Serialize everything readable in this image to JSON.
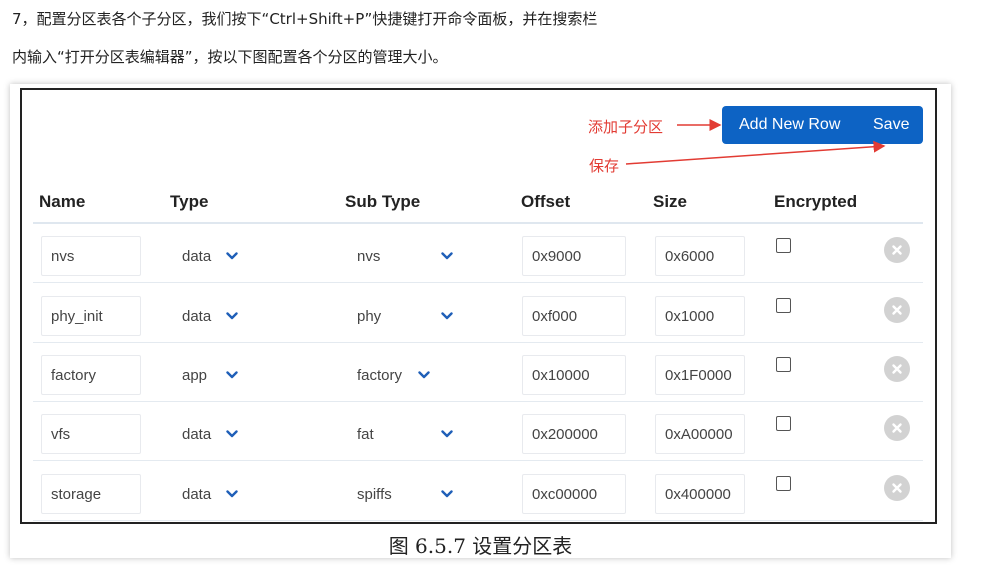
{
  "document": {
    "paragraph_line1": "7，配置分区表各个子分区，我们按下“Ctrl+Shift+P”快捷键打开命令面板，并在搜索栏",
    "paragraph_line2": "内输入“打开分区表编辑器”，按以下图配置各个分区的管理大小。",
    "caption": "图 6.5.7 设置分区表"
  },
  "editor": {
    "add_row_label": "Add New Row",
    "save_label": "Save",
    "annotation_add": "添加子分区",
    "annotation_save": "保存",
    "annotation_color": "#e23b33",
    "accent_color": "#0d63c4",
    "columns": {
      "name": "Name",
      "type": "Type",
      "subtype": "Sub Type",
      "offset": "Offset",
      "size": "Size",
      "encrypted": "Encrypted"
    },
    "rows": [
      {
        "name": "nvs",
        "type": "data",
        "subtype": "nvs",
        "offset": "0x9000",
        "size": "0x6000",
        "encrypted": false
      },
      {
        "name": "phy_init",
        "type": "data",
        "subtype": "phy",
        "offset": "0xf000",
        "size": "0x1000",
        "encrypted": false
      },
      {
        "name": "factory",
        "type": "app",
        "subtype": "factory",
        "offset": "0x10000",
        "size": "0x1F0000",
        "encrypted": false
      },
      {
        "name": "vfs",
        "type": "data",
        "subtype": "fat",
        "offset": "0x200000",
        "size": "0xA00000",
        "encrypted": false
      },
      {
        "name": "storage",
        "type": "data",
        "subtype": "spiffs",
        "offset": "0xc00000",
        "size": "0x400000",
        "encrypted": false
      }
    ],
    "icons": {
      "dropdown": "chevron-down-icon",
      "delete": "close-circle-icon",
      "checkbox": "checkbox-icon"
    }
  }
}
